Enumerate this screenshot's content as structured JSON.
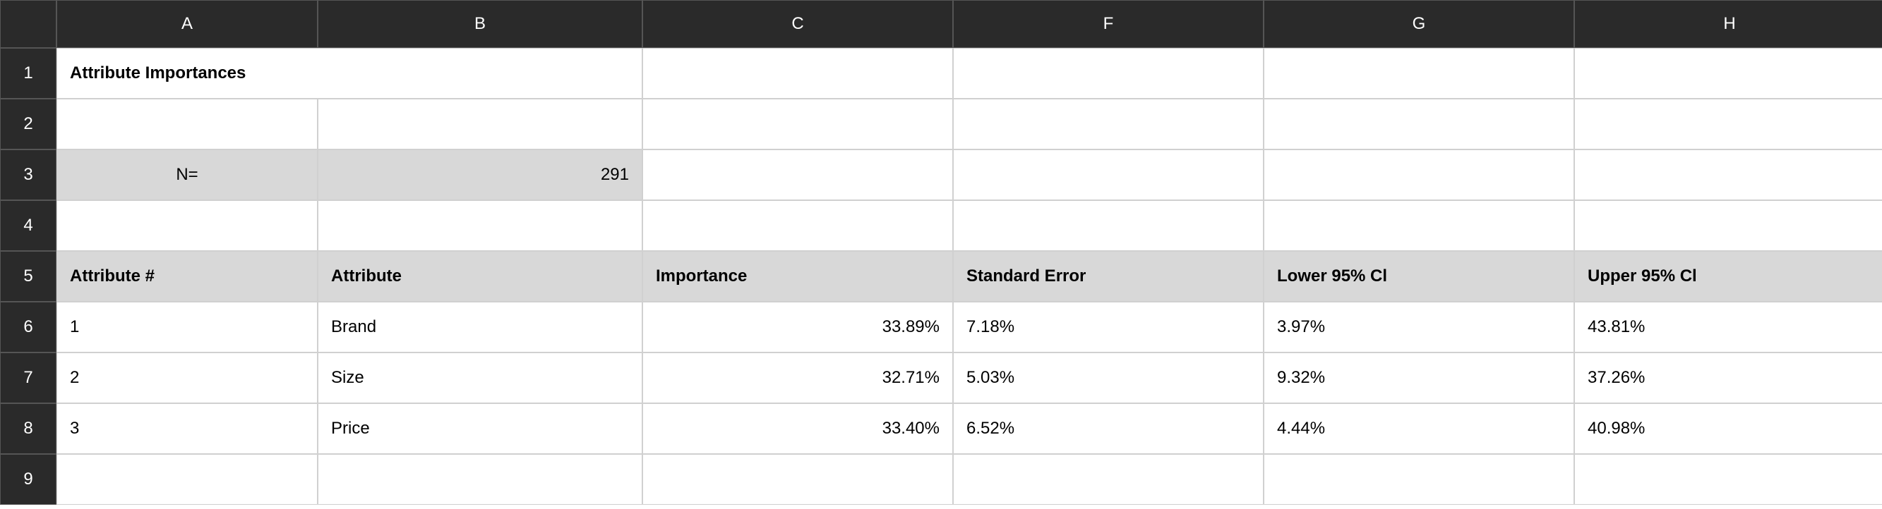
{
  "columns": [
    "A",
    "B",
    "C",
    "F",
    "G",
    "H"
  ],
  "rowNumbers": [
    "1",
    "2",
    "3",
    "4",
    "5",
    "6",
    "7",
    "8",
    "9"
  ],
  "title": "Attribute Importances",
  "sampleSize": {
    "label": "N=",
    "value": "291"
  },
  "headers": {
    "attributeNum": "Attribute #",
    "attribute": "Attribute",
    "importance": "Importance",
    "stdError": "Standard Error",
    "lowerCI": "Lower 95% Cl",
    "upperCI": "Upper 95% Cl"
  },
  "rows": [
    {
      "num": "1",
      "attribute": "Brand",
      "importance": "33.89%",
      "stdError": "7.18%",
      "lowerCI": "3.97%",
      "upperCI": "43.81%"
    },
    {
      "num": "2",
      "attribute": "Size",
      "importance": "32.71%",
      "stdError": "5.03%",
      "lowerCI": "9.32%",
      "upperCI": "37.26%"
    },
    {
      "num": "3",
      "attribute": "Price",
      "importance": "33.40%",
      "stdError": "6.52%",
      "lowerCI": "4.44%",
      "upperCI": "40.98%"
    }
  ]
}
